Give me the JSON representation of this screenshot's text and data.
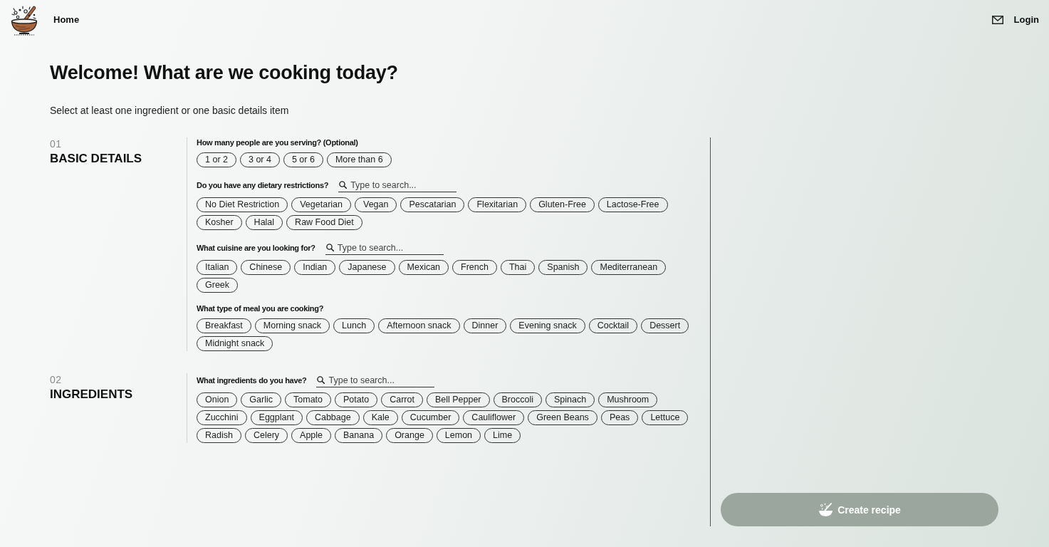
{
  "header": {
    "nav": [
      {
        "label": "Home"
      }
    ],
    "login": "Login"
  },
  "intro": {
    "title": "Welcome! What are we cooking today?",
    "subtitle": "Select at least one ingredient or one basic details item"
  },
  "sections": [
    {
      "number": "01",
      "title": "BASIC DETAILS",
      "questions": [
        {
          "label": "How many people are you serving? (Optional)",
          "options": [
            {
              "label": "1 or 2",
              "selected": false
            },
            {
              "label": "3 or 4",
              "selected": false
            },
            {
              "label": "5 or 6",
              "selected": false
            },
            {
              "label": "More than 6",
              "selected": false
            }
          ]
        },
        {
          "label": "Do you have any dietary restrictions?",
          "search": {
            "placeholder": "Type to search..."
          },
          "options": [
            {
              "label": "No Diet Restriction",
              "selected": false
            },
            {
              "label": "Vegetarian",
              "selected": false
            },
            {
              "label": "Vegan",
              "selected": false
            },
            {
              "label": "Pescatarian",
              "selected": false
            },
            {
              "label": "Flexitarian",
              "selected": false
            },
            {
              "label": "Gluten-Free",
              "selected": false
            },
            {
              "label": "Lactose-Free",
              "selected": false
            },
            {
              "label": "Kosher",
              "selected": false
            },
            {
              "label": "Halal",
              "selected": false
            },
            {
              "label": "Raw Food Diet",
              "selected": false
            }
          ]
        },
        {
          "label": "What cuisine are you looking for?",
          "search": {
            "placeholder": "Type to search..."
          },
          "options": [
            {
              "label": "Italian",
              "selected": false
            },
            {
              "label": "Chinese",
              "selected": false
            },
            {
              "label": "Indian",
              "selected": false
            },
            {
              "label": "Japanese",
              "selected": false
            },
            {
              "label": "Mexican",
              "selected": false
            },
            {
              "label": "French",
              "selected": false
            },
            {
              "label": "Thai",
              "selected": false
            },
            {
              "label": "Spanish",
              "selected": false
            },
            {
              "label": "Mediterranean",
              "selected": false
            },
            {
              "label": "Greek",
              "selected": false
            }
          ]
        },
        {
          "label": "What type of meal you are cooking?",
          "options": [
            {
              "label": "Breakfast",
              "selected": false
            },
            {
              "label": "Morning snack",
              "selected": false
            },
            {
              "label": "Lunch",
              "selected": false
            },
            {
              "label": "Afternoon snack",
              "selected": false
            },
            {
              "label": "Dinner",
              "selected": false
            },
            {
              "label": "Evening snack",
              "selected": false
            },
            {
              "label": "Cocktail",
              "selected": false
            },
            {
              "label": "Dessert",
              "selected": false
            },
            {
              "label": "Midnight snack",
              "selected": false
            }
          ]
        }
      ]
    },
    {
      "number": "02",
      "title": "INGREDIENTS",
      "questions": [
        {
          "label": "What ingredients do you have?",
          "search": {
            "placeholder": "Type to search..."
          },
          "options": [
            {
              "label": "Onion",
              "selected": false
            },
            {
              "label": "Garlic",
              "selected": false
            },
            {
              "label": "Tomato",
              "selected": false
            },
            {
              "label": "Potato",
              "selected": false
            },
            {
              "label": "Carrot",
              "selected": false
            },
            {
              "label": "Bell Pepper",
              "selected": false
            },
            {
              "label": "Broccoli",
              "selected": false
            },
            {
              "label": "Spinach",
              "selected": false
            },
            {
              "label": "Mushroom",
              "selected": false
            },
            {
              "label": "Zucchini",
              "selected": false
            },
            {
              "label": "Eggplant",
              "selected": false
            },
            {
              "label": "Cabbage",
              "selected": false
            },
            {
              "label": "Kale",
              "selected": false
            },
            {
              "label": "Cucumber",
              "selected": false
            },
            {
              "label": "Cauliflower",
              "selected": false
            },
            {
              "label": "Green Beans",
              "selected": false
            },
            {
              "label": "Peas",
              "selected": false
            },
            {
              "label": "Lettuce",
              "selected": false
            },
            {
              "label": "Radish",
              "selected": false
            },
            {
              "label": "Celery",
              "selected": false
            },
            {
              "label": "Apple",
              "selected": false
            },
            {
              "label": "Banana",
              "selected": false
            },
            {
              "label": "Orange",
              "selected": false
            },
            {
              "label": "Lemon",
              "selected": false
            },
            {
              "label": "Lime",
              "selected": false
            }
          ]
        }
      ]
    }
  ],
  "create_button": {
    "label": "Create recipe",
    "disabled": true
  }
}
